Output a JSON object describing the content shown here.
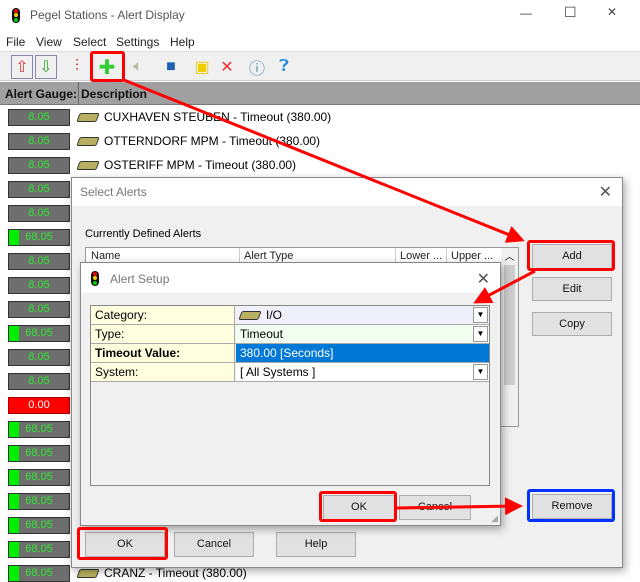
{
  "window": {
    "title": "Pegel Stations - Alert Display",
    "controls": [
      "—",
      "☐",
      "✕"
    ]
  },
  "menu": [
    "File",
    "View",
    "Select",
    "Settings",
    "Help"
  ],
  "toolbar": {
    "icons": [
      "scroll-up-icon",
      "scroll-down-icon",
      "sliders-icon",
      "add-icon",
      "speaker-icon",
      "save-icon",
      "open-folder-icon",
      "delete-icon",
      "info-icon",
      "help-icon"
    ]
  },
  "table": {
    "headers": [
      "Alert Gauge:",
      "Description"
    ],
    "rows": [
      {
        "value": "8.05",
        "state": "low",
        "desc": "CUXHAVEN STEUBEN - Timeout (380.00)"
      },
      {
        "value": "8.05",
        "state": "low",
        "desc": "OTTERNDORF MPM - Timeout (380.00)"
      },
      {
        "value": "8.05",
        "state": "low",
        "desc": "OSTERIFF MPM - Timeout (380.00)"
      },
      {
        "value": "8.05",
        "state": "low"
      },
      {
        "value": "8.05",
        "state": "low"
      },
      {
        "value": "68.05",
        "state": "bar"
      },
      {
        "value": "8.05",
        "state": "low"
      },
      {
        "value": "8.05",
        "state": "low"
      },
      {
        "value": "8.05",
        "state": "low"
      },
      {
        "value": "68.05",
        "state": "bar"
      },
      {
        "value": "8.05",
        "state": "low"
      },
      {
        "value": "8.05",
        "state": "low"
      },
      {
        "value": "0.00",
        "state": "alarm"
      },
      {
        "value": "68.05",
        "state": "bar"
      },
      {
        "value": "68.05",
        "state": "bar"
      },
      {
        "value": "68.05",
        "state": "bar"
      },
      {
        "value": "68.05",
        "state": "bar"
      },
      {
        "value": "68.05",
        "state": "bar"
      },
      {
        "value": "68.05",
        "state": "bar"
      },
      {
        "value": "68.05",
        "state": "bar",
        "desc": "CRANZ - Timeout (380.00)"
      }
    ]
  },
  "select_alerts": {
    "title": "Select Alerts",
    "section": "Currently Defined Alerts",
    "columns": [
      "Name",
      "Alert Type",
      "Lower ...",
      "Upper ..."
    ],
    "buttons": {
      "add": "Add",
      "edit": "Edit",
      "copy": "Copy",
      "remove": "Remove",
      "ok": "OK",
      "cancel": "Cancel",
      "help": "Help"
    }
  },
  "alert_setup": {
    "title": "Alert Setup",
    "fields": [
      {
        "label": "Category:",
        "value": "I/O"
      },
      {
        "label": "Type:",
        "value": "Timeout"
      },
      {
        "label": "Timeout Value:",
        "value": "380.00 [Seconds]"
      },
      {
        "label": "System:",
        "value": "[ All Systems ]"
      }
    ],
    "buttons": {
      "ok": "OK",
      "cancel": "Cancel"
    }
  },
  "colors": {
    "gauge_ok": "#2ee82e",
    "gauge_alarm": "#ff0000",
    "selection": "#0078d7",
    "annotation_red": "#ff0000",
    "annotation_blue": "#0033ff"
  }
}
